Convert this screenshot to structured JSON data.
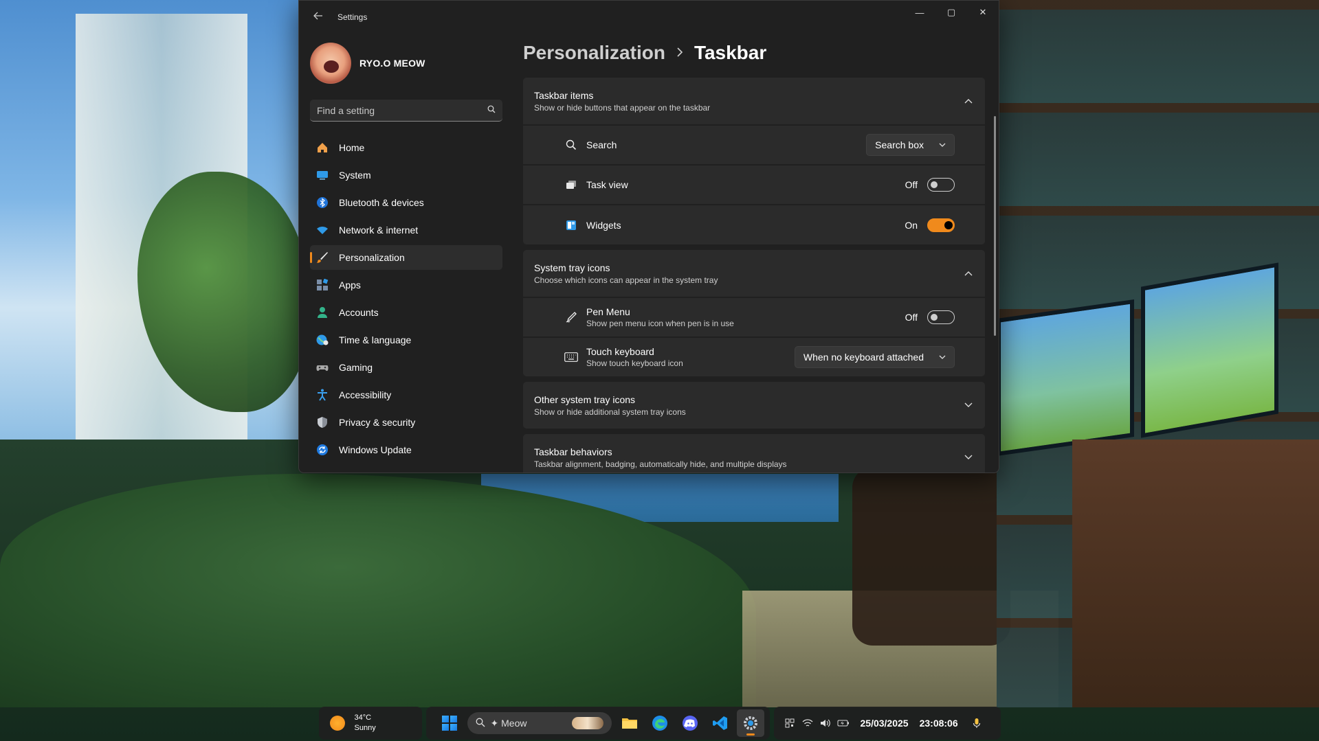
{
  "window": {
    "title": "Settings",
    "controls": {
      "minimize": "—",
      "maximize": "▢",
      "close": "✕"
    }
  },
  "profile": {
    "name": "RYO.O MEOW"
  },
  "search": {
    "placeholder": "Find a setting"
  },
  "sidebar": {
    "items": [
      {
        "label": "Home",
        "icon": "home-icon"
      },
      {
        "label": "System",
        "icon": "system-icon"
      },
      {
        "label": "Bluetooth & devices",
        "icon": "bluetooth-icon"
      },
      {
        "label": "Network & internet",
        "icon": "wifi-icon"
      },
      {
        "label": "Personalization",
        "icon": "brush-icon",
        "active": true
      },
      {
        "label": "Apps",
        "icon": "apps-icon"
      },
      {
        "label": "Accounts",
        "icon": "account-icon"
      },
      {
        "label": "Time & language",
        "icon": "globe-icon"
      },
      {
        "label": "Gaming",
        "icon": "gamepad-icon"
      },
      {
        "label": "Accessibility",
        "icon": "accessibility-icon"
      },
      {
        "label": "Privacy & security",
        "icon": "shield-icon"
      },
      {
        "label": "Windows Update",
        "icon": "update-icon"
      }
    ]
  },
  "breadcrumb": {
    "parent": "Personalization",
    "current": "Taskbar"
  },
  "sections": {
    "taskbar_items": {
      "title": "Taskbar items",
      "subtitle": "Show or hide buttons that appear on the taskbar",
      "search": {
        "label": "Search",
        "value": "Search box"
      },
      "task_view": {
        "label": "Task view",
        "state": "Off"
      },
      "widgets": {
        "label": "Widgets",
        "state": "On"
      }
    },
    "system_tray": {
      "title": "System tray icons",
      "subtitle": "Choose which icons can appear in the system tray",
      "pen_menu": {
        "label": "Pen Menu",
        "sub": "Show pen menu icon when pen is in use",
        "state": "Off"
      },
      "touch_keyboard": {
        "label": "Touch keyboard",
        "sub": "Show touch keyboard icon",
        "value": "When no keyboard attached"
      }
    },
    "other_tray": {
      "title": "Other system tray icons",
      "subtitle": "Show or hide additional system tray icons"
    },
    "behaviors": {
      "title": "Taskbar behaviors",
      "subtitle": "Taskbar alignment, badging, automatically hide, and multiple displays"
    }
  },
  "taskbar": {
    "weather": {
      "temp": "34°C",
      "condition": "Sunny"
    },
    "search_text": "✦ Meow",
    "date": "25/03/2025",
    "time": "23:08:06"
  },
  "colors": {
    "accent": "#f08a1c",
    "window_bg": "#202020",
    "card_bg": "#2b2b2b"
  }
}
